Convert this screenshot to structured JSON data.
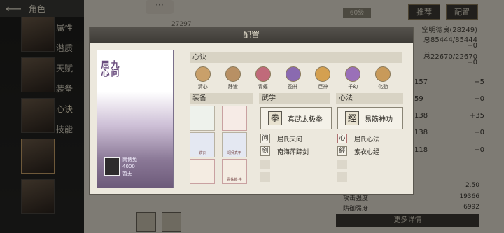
{
  "sidebar": {
    "title": "角色",
    "nav": [
      "属性",
      "潜质",
      "天赋",
      "装备",
      "心诀",
      "技能"
    ]
  },
  "background": {
    "buttons": {
      "recommend": "推荐",
      "config": "配置"
    },
    "tag": "60级",
    "number": "27297",
    "stats_lines": [
      "空明德良(28249)",
      "总85444/85444",
      "+0",
      "总22670/22670",
      "+0"
    ],
    "rows": [
      {
        "value": "157",
        "extra": "+5"
      },
      {
        "value": "59",
        "extra": "+0"
      },
      {
        "value": "138",
        "extra": "+35"
      },
      {
        "value": "138",
        "extra": "+0"
      },
      {
        "value": "118",
        "extra": "+0"
      }
    ],
    "footer": [
      {
        "label": "",
        "value": "2.50"
      },
      {
        "label": "攻击强度",
        "value": "19366"
      },
      {
        "label": "防御强度",
        "value": "6992"
      }
    ],
    "more": "更多详情"
  },
  "modal": {
    "title": "配置",
    "portrait": {
      "title": "九问",
      "subtitle": "屈心"
    },
    "author": {
      "name": "南博兔",
      "value": "4000",
      "note": "暂无"
    },
    "sections": {
      "xinjue": "心诀",
      "equip": "装备",
      "wuxue": "武学",
      "xinfa": "心法"
    },
    "xinjue": [
      "清心",
      "静谧",
      "青蝠",
      "盈神",
      "巨神",
      "千幻",
      "化劲"
    ],
    "equip_labels": [
      "",
      "",
      "铁衣",
      "翊师真甲",
      "",
      "青铁锁·手"
    ],
    "wuxue": {
      "main": "真武太极拳",
      "subs": [
        "屈氏天问",
        "南海萍踪剑"
      ]
    },
    "xinfa": {
      "main": "易筋神功",
      "subs": [
        "屈氏心法",
        "素衣心经"
      ]
    }
  },
  "colors": {
    "accent": "#6a4d7e",
    "header": "#3e3c37"
  }
}
